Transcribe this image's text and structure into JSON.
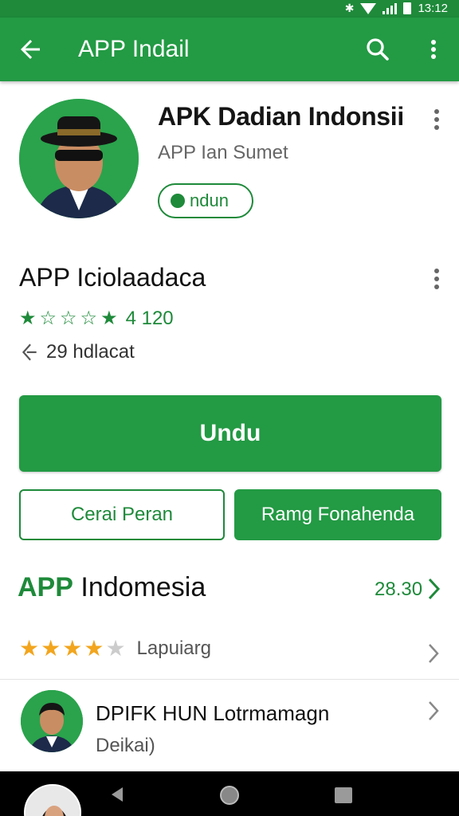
{
  "status_bar": {
    "time": "13:12"
  },
  "app_bar": {
    "title": "APP Indail"
  },
  "header": {
    "app_name": "APK Dadian Indonsii",
    "subtitle": "APP Ian Sumet",
    "chip_label": "ndun"
  },
  "rating_section": {
    "title": "APP Iciolaadaca",
    "rating_value": "4 120",
    "downloads": "29 hdlacat"
  },
  "buttons": {
    "primary": "Undu",
    "secondary_outline": "Cerai Peran",
    "secondary_filled": "Ramg Fonahenda"
  },
  "indonesia_section": {
    "heading_accent": "APP",
    "heading_rest": " Indomesia",
    "count": "28.30",
    "review_label": "Lapuiarg"
  },
  "developer": {
    "name": "DPIFK HUN Lotrmamagn",
    "sub": "Deikai)"
  },
  "colors": {
    "brand_green": "#239a44",
    "dark_green": "#1e8a3a",
    "star_gold": "#f2a51d"
  },
  "icons": [
    "back-arrow-icon",
    "search-icon",
    "more-vert-icon",
    "download-icon",
    "chevron-right-icon",
    "nav-back-icon",
    "nav-home-icon",
    "nav-recents-icon"
  ]
}
